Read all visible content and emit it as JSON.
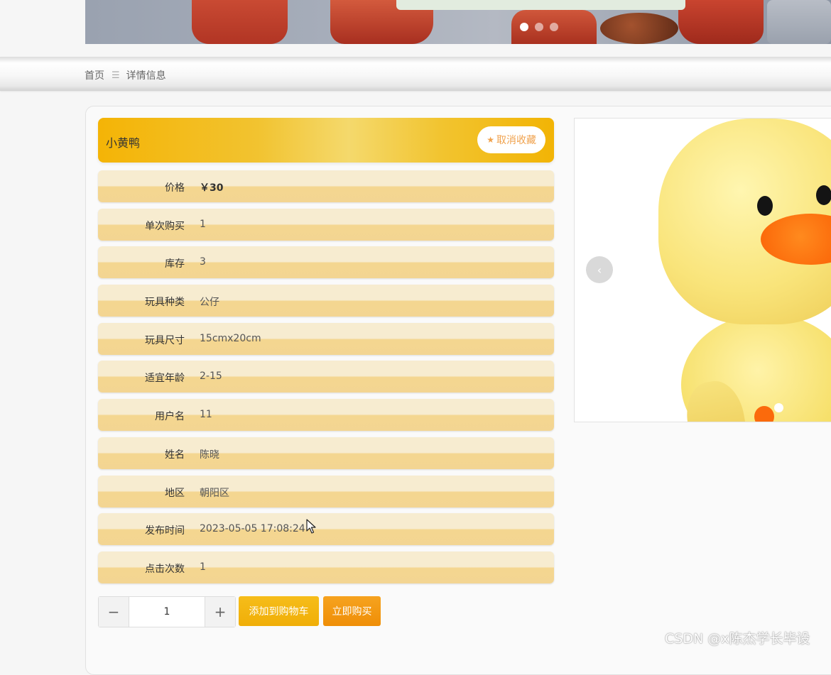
{
  "banner": {
    "slide_count": 3,
    "active_slide": 1
  },
  "breadcrumb": {
    "home": "首页",
    "separator": "☰",
    "current": "详情信息"
  },
  "product": {
    "name": "小黄鸭",
    "favorite_label": "取消收藏",
    "fields": [
      {
        "label": "价格",
        "value": "￥30"
      },
      {
        "label": "单次购买",
        "value": "1"
      },
      {
        "label": "库存",
        "value": "3"
      },
      {
        "label": "玩具种类",
        "value": "公仔"
      },
      {
        "label": "玩具尺寸",
        "value": "15cmx20cm"
      },
      {
        "label": "适宜年龄",
        "value": "2-15"
      },
      {
        "label": "用户名",
        "value": "11"
      },
      {
        "label": "姓名",
        "value": "陈晓"
      },
      {
        "label": "地区",
        "value": "朝阳区"
      },
      {
        "label": "发布时间",
        "value": "2023-05-05 17:08:24"
      },
      {
        "label": "点击次数",
        "value": "1"
      }
    ]
  },
  "purchase": {
    "minus": "−",
    "quantity": "1",
    "plus": "+",
    "add_to_cart": "添加到购物车",
    "buy_now": "立即购买"
  },
  "carousel": {
    "prev_icon": "‹"
  },
  "watermark": "CSDN @x陈杰学长毕设",
  "colors": {
    "title_bar": "#f4b406",
    "row_light": "#f7ecd0",
    "row_dark": "#f3d592",
    "cart_button": "#f0ae07",
    "buy_button": "#ef8e07",
    "favorite_text": "#f0a24d"
  }
}
